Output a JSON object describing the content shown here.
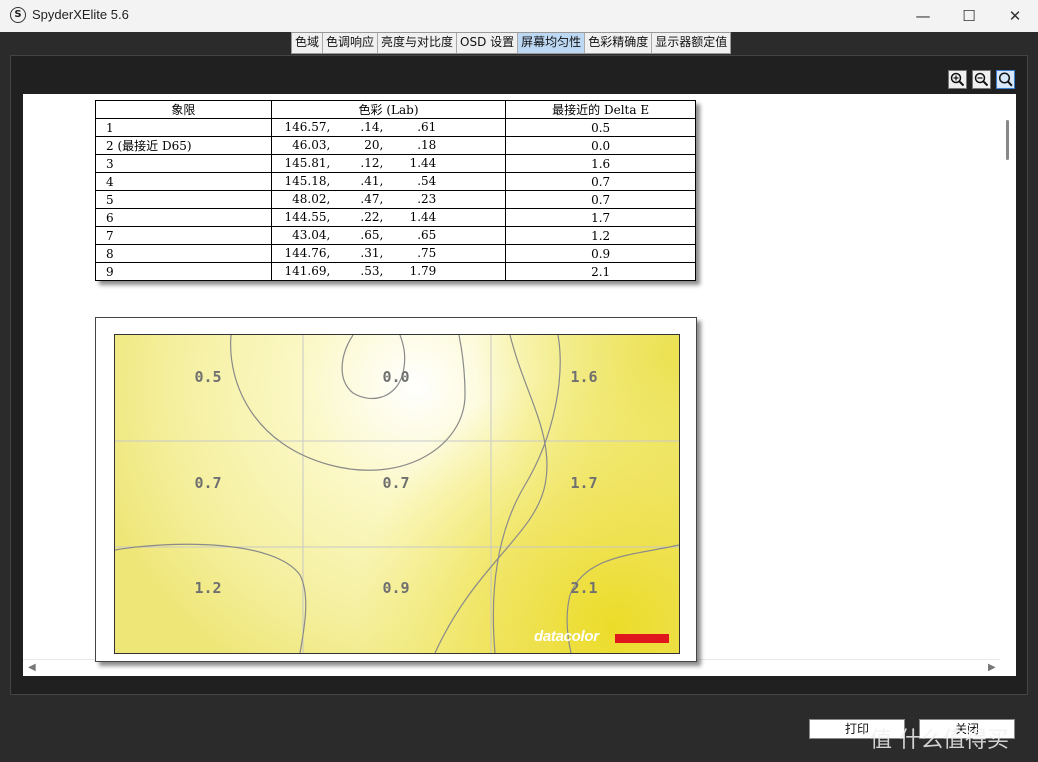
{
  "window": {
    "title": "SpyderXElite 5.6",
    "icon_letter": "S"
  },
  "tabs": [
    "色域",
    "色调响应",
    "亮度与对比度",
    "OSD 设置",
    "屏幕均匀性",
    "色彩精确度",
    "显示器额定值"
  ],
  "active_tab": "屏幕均匀性",
  "zoom_tools": [
    "zoom-in-icon",
    "zoom-out-icon",
    "zoom-fit-icon"
  ],
  "table": {
    "headers": [
      "象限",
      "色彩 (Lab)",
      "最接近的 Delta E"
    ],
    "rows": [
      {
        "q": "1",
        "l": "146.57,",
        "a": ".14,",
        "b": ".61",
        "de": "0.5"
      },
      {
        "q": "2 (最接近 D65)",
        "l": "46.03,",
        "a": "20,",
        "b": ".18",
        "de": "0.0"
      },
      {
        "q": "3",
        "l": "145.81,",
        "a": ".12,",
        "b": "1.44",
        "de": "1.6"
      },
      {
        "q": "4",
        "l": "145.18,",
        "a": ".41,",
        "b": ".54",
        "de": "0.7"
      },
      {
        "q": "5",
        "l": "48.02,",
        "a": ".47,",
        "b": ".23",
        "de": "0.7"
      },
      {
        "q": "6",
        "l": "144.55,",
        "a": ".22,",
        "b": "1.44",
        "de": "1.7"
      },
      {
        "q": "7",
        "l": "43.04,",
        "a": ".65,",
        "b": ".65",
        "de": "1.2"
      },
      {
        "q": "8",
        "l": "144.76,",
        "a": ".31,",
        "b": ".75",
        "de": "0.9"
      },
      {
        "q": "9",
        "l": "141.69,",
        "a": ".53,",
        "b": "1.79",
        "de": "2.1"
      }
    ]
  },
  "uniformity_map": {
    "cells": [
      "0.5",
      "0.0",
      "1.6",
      "0.7",
      "0.7",
      "1.7",
      "1.2",
      "0.9",
      "2.1"
    ],
    "colors": {
      "low": "#ffffff",
      "high": "#ecdc28"
    }
  },
  "brand": {
    "text": "datacolor",
    "bar_color": "#e0181e"
  },
  "buttons": {
    "print": "打印",
    "close": "关闭"
  },
  "watermark": "值 什么值得买"
}
